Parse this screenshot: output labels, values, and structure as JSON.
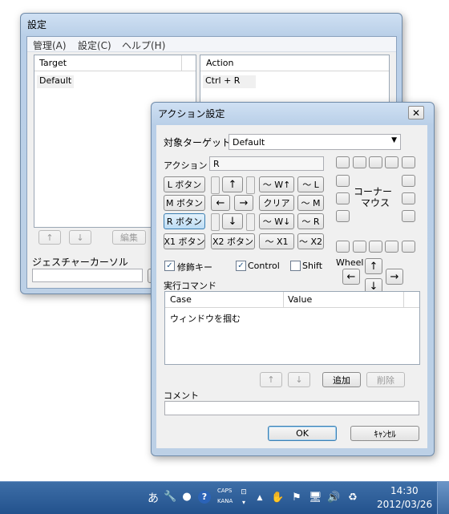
{
  "settings_window": {
    "title": "設定",
    "menus": [
      "管理(A)",
      "設定(C)",
      "ヘルプ(H)"
    ],
    "left_list": {
      "header": "Target",
      "rows": [
        "Default"
      ]
    },
    "right_list": {
      "header": "Action",
      "rows": [
        "Ctrl + R"
      ]
    },
    "buttons": {
      "up": "↑",
      "down": "↓",
      "edit": "編集"
    },
    "gesture_cursor_label": "ジェスチャーカーソル"
  },
  "action_dialog": {
    "title": "アクション設定",
    "target_label": "対象ターゲット",
    "target_value": "Default",
    "action_label": "アクション",
    "action_value": "R",
    "mouse_buttons": [
      {
        "label": "L ボタン",
        "selected": false
      },
      {
        "label": "M ボタン",
        "selected": false
      },
      {
        "label": "R ボタン",
        "selected": true
      },
      {
        "label": "X1 ボタン",
        "selected": false
      }
    ],
    "x2_button": "X2 ボタン",
    "arrows": {
      "up": "↑",
      "left": "←",
      "right": "→",
      "down": "↓"
    },
    "wheel_up": "～ W↑",
    "clear": "クリア",
    "wheel_down": "～ W↓",
    "tilde_x1": "～ X1",
    "tilde_l": "～ L",
    "tilde_m": "～ M",
    "tilde_r": "～ R",
    "tilde_x2": "～ X2",
    "corner_label_1": "コーナー",
    "corner_label_2": "マウス",
    "wheel_label": "Wheel",
    "wheel_arrows": {
      "up": "↑",
      "left": "←",
      "right": "→",
      "down": "↓"
    },
    "modifier_key": {
      "label": "修飾キー",
      "checked": true
    },
    "control": {
      "label": "Control",
      "checked": true
    },
    "shift": {
      "label": "Shift",
      "checked": false
    },
    "exec_command_label": "実行コマンド",
    "command_table": {
      "headers": [
        "Case",
        "Value"
      ],
      "rows": [
        {
          "case": "ウィンドウを掴む",
          "value": ""
        }
      ]
    },
    "cmd_up": "↑",
    "cmd_down": "↓",
    "add": "追加",
    "delete": "削除",
    "comment_label": "コメント",
    "comment_value": "",
    "ok": "OK",
    "cancel": "ｷｬﾝｾﾙ"
  },
  "taskbar": {
    "ime": "あ",
    "caps": "CAPS",
    "kana": "KANA",
    "time": "14:30",
    "date": "2012/03/26"
  }
}
